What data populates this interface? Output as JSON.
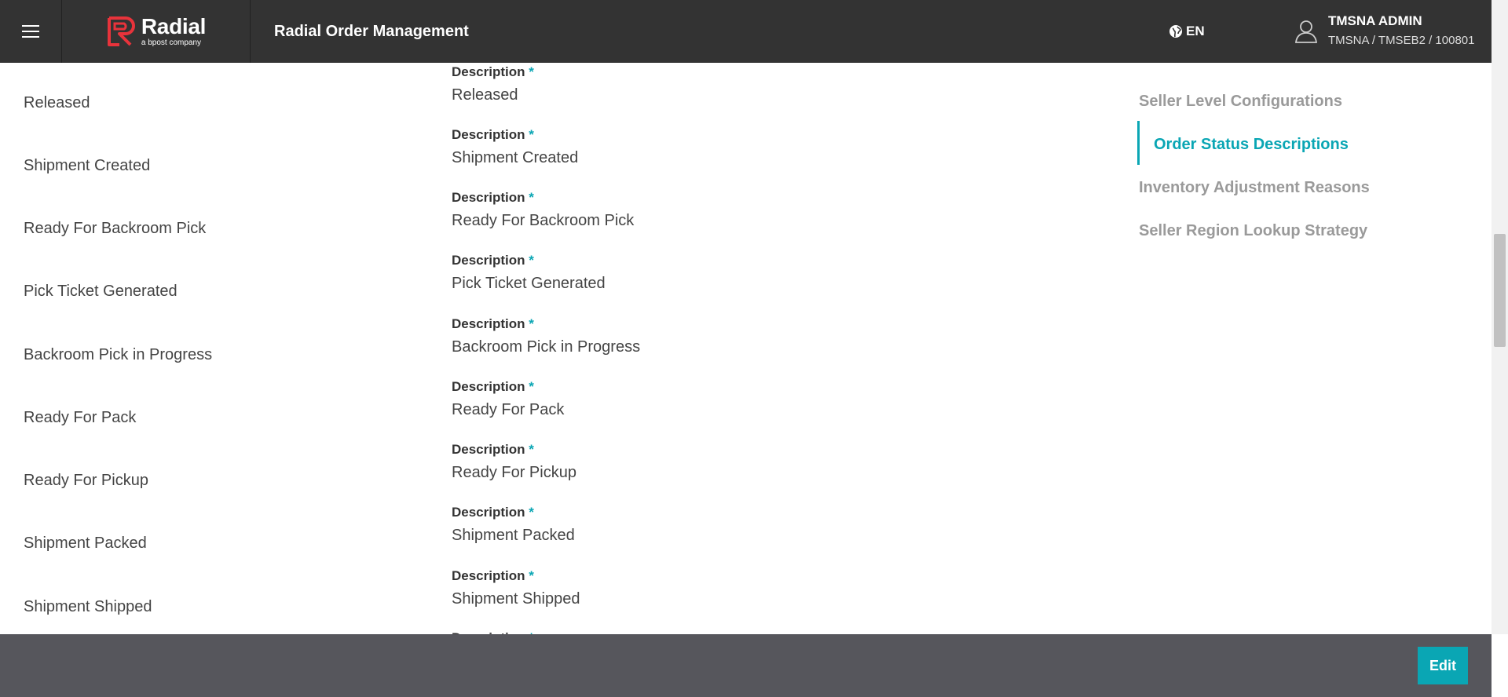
{
  "header": {
    "brand_name": "Radial",
    "brand_tagline": "a bpost company",
    "app_title": "Radial Order Management",
    "language": "EN",
    "user_name": "TMSNA ADMIN",
    "user_context": "TMSNA / TMSEB2 / 100801"
  },
  "statuses": [
    {
      "name": "Released",
      "label": "Description",
      "value": "Released"
    },
    {
      "name": "Shipment Created",
      "label": "Description",
      "value": "Shipment Created"
    },
    {
      "name": "Ready For Backroom Pick",
      "label": "Description",
      "value": "Ready For Backroom Pick"
    },
    {
      "name": "Pick Ticket Generated",
      "label": "Description",
      "value": "Pick Ticket Generated"
    },
    {
      "name": "Backroom Pick in Progress",
      "label": "Description",
      "value": "Backroom Pick in Progress"
    },
    {
      "name": "Ready For Pack",
      "label": "Description",
      "value": "Ready For Pack"
    },
    {
      "name": "Ready For Pickup",
      "label": "Description",
      "value": "Ready For Pickup"
    },
    {
      "name": "Shipment Packed",
      "label": "Description",
      "value": "Shipment Packed"
    },
    {
      "name": "Shipment Shipped",
      "label": "Description",
      "value": "Shipment Shipped"
    },
    {
      "name": "",
      "label": "Description",
      "value": ""
    }
  ],
  "required_marker": "*",
  "right_nav": {
    "items": [
      {
        "label": "Seller Level Configurations",
        "active": false
      },
      {
        "label": "Order Status Descriptions",
        "active": true
      },
      {
        "label": "Inventory Adjustment Reasons",
        "active": false
      },
      {
        "label": "Seller Region Lookup Strategy",
        "active": false
      }
    ]
  },
  "footer": {
    "edit_label": "Edit"
  },
  "colors": {
    "header_bg": "#333333",
    "accent": "#0aa6b4",
    "footer_bg": "#56565c",
    "nav_inactive": "#9a9a9a"
  }
}
